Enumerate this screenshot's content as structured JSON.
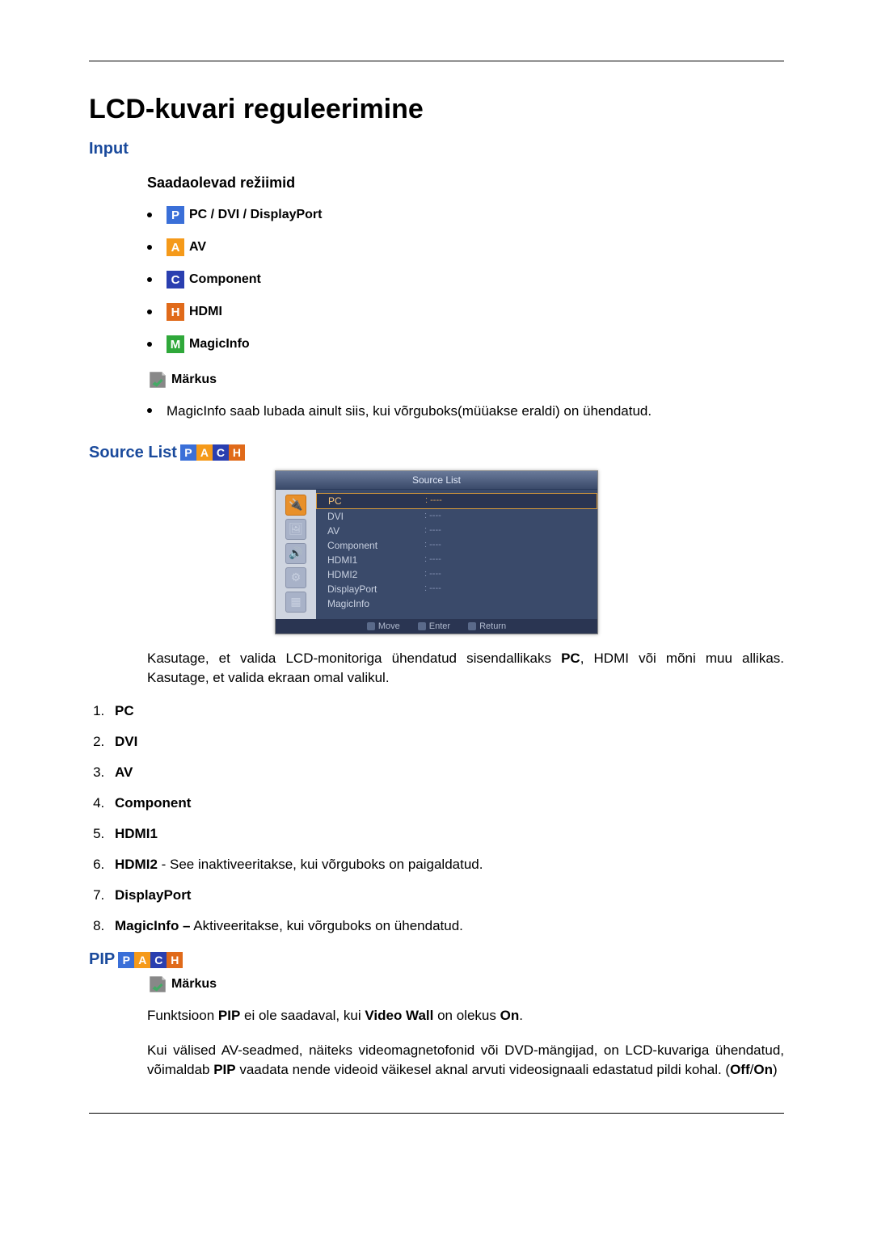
{
  "title": "LCD-kuvari reguleerimine",
  "input_heading": "Input",
  "modes_heading": "Saadaolevad režiimid",
  "modes": {
    "p": {
      "letter": "P",
      "label": " PC / DVI / DisplayPort"
    },
    "a": {
      "letter": "A",
      "label": " AV"
    },
    "c": {
      "letter": "C",
      "label": " Component"
    },
    "h": {
      "letter": "H",
      "label": " HDMI"
    },
    "m": {
      "letter": "M",
      "label": " MagicInfo"
    }
  },
  "note_label": "Märkus",
  "note1_text": "MagicInfo saab lubada ainult siis, kui võrguboks(müüakse eraldi) on ühendatud.",
  "source_list_label": "Source List",
  "osd": {
    "title": "Source List",
    "rows": {
      "r1": {
        "name": "PC",
        "val": ": ----"
      },
      "r2": {
        "name": "DVI",
        "val": ": ----"
      },
      "r3": {
        "name": "AV",
        "val": ": ----"
      },
      "r4": {
        "name": "Component",
        "val": ": ----"
      },
      "r5": {
        "name": "HDMI1",
        "val": ": ----"
      },
      "r6": {
        "name": "HDMI2",
        "val": ": ----"
      },
      "r7": {
        "name": "DisplayPort",
        "val": ": ----"
      },
      "r8": {
        "name": "MagicInfo",
        "val": ""
      }
    },
    "footer": {
      "move": "Move",
      "enter": "Enter",
      "return": "Return"
    }
  },
  "source_para_pre": "Kasutage, et valida LCD-monitoriga ühendatud sisendallikaks ",
  "source_para_bold": "PC",
  "source_para_post": ", HDMI või mõni muu allikas. Kasutage, et valida ekraan omal valikul.",
  "list": {
    "i1": "PC",
    "i2": "DVI",
    "i3": "AV",
    "i4": "Component",
    "i5": "HDMI1",
    "i6b": "HDMI2",
    "i6t": " - See inaktiveeritakse, kui võrguboks on paigaldatud.",
    "i7": "DisplayPort",
    "i8b": "MagicInfo –",
    "i8t": " Aktiveeritakse, kui võrguboks on ühendatud."
  },
  "pip_label": "PIP",
  "pip_note_pre": "Funktsioon ",
  "pip_note_b1": "PIP",
  "pip_note_mid": " ei ole saadaval, kui ",
  "pip_note_b2": "Video Wall",
  "pip_note_mid2": " on olekus ",
  "pip_note_b3": "On",
  "pip_note_end": ".",
  "pip_para_pre": "Kui välised AV-seadmed, näiteks videomagnetofonid või DVD-mängijad, on LCD-kuvariga ühendatud, võimaldab ",
  "pip_para_b1": "PIP",
  "pip_para_mid": " vaadata nende videoid väikesel aknal arvuti videosignaali edastatud pildi kohal. (",
  "pip_para_b2": "Off",
  "pip_para_slash": "/",
  "pip_para_b3": "On",
  "pip_para_end": ")"
}
